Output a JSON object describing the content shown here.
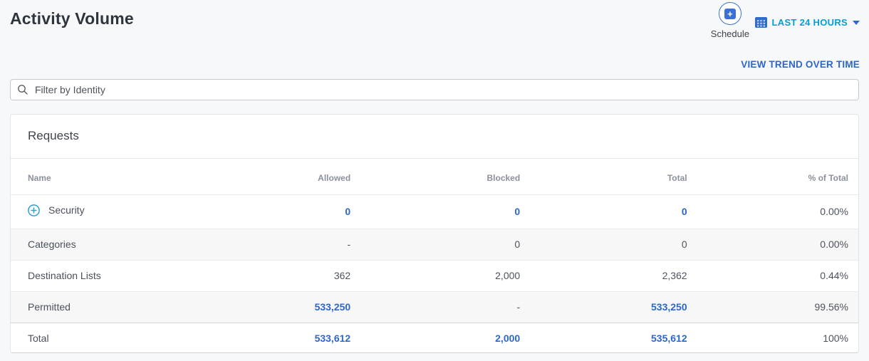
{
  "page_title": "Activity Volume",
  "header": {
    "schedule": {
      "label": "Schedule"
    },
    "time_range": {
      "label": "LAST 24 HOURS"
    },
    "view_trend_label": "VIEW TREND OVER TIME"
  },
  "filter": {
    "placeholder": "Filter by Identity"
  },
  "requests": {
    "title": "Requests",
    "columns": [
      "Name",
      "Allowed",
      "Blocked",
      "Total",
      "% of Total"
    ],
    "rows": [
      {
        "name": "Security",
        "allowed": "0",
        "blocked": "0",
        "total": "0",
        "pct_of_total": "0.00%"
      },
      {
        "name": "Categories",
        "allowed": "-",
        "blocked": "0",
        "total": "0",
        "pct_of_total": "0.00%"
      },
      {
        "name": "Destination Lists",
        "allowed": "362",
        "blocked": "2,000",
        "total": "2,362",
        "pct_of_total": "0.44%"
      },
      {
        "name": "Permitted",
        "allowed": "533,250",
        "blocked": "-",
        "total": "533,250",
        "pct_of_total": "99.56%"
      },
      {
        "name": "Total",
        "allowed": "533,612",
        "blocked": "2,000",
        "total": "535,612",
        "pct_of_total": "100%"
      }
    ]
  },
  "colors": {
    "link_blue": "#2b67cb",
    "time_range_blue": "#00a0d6",
    "expand_icon_blue": "#2aa0dc",
    "title_dark": "#2f353e",
    "zebra_row_bg": "#f7f7f8"
  }
}
